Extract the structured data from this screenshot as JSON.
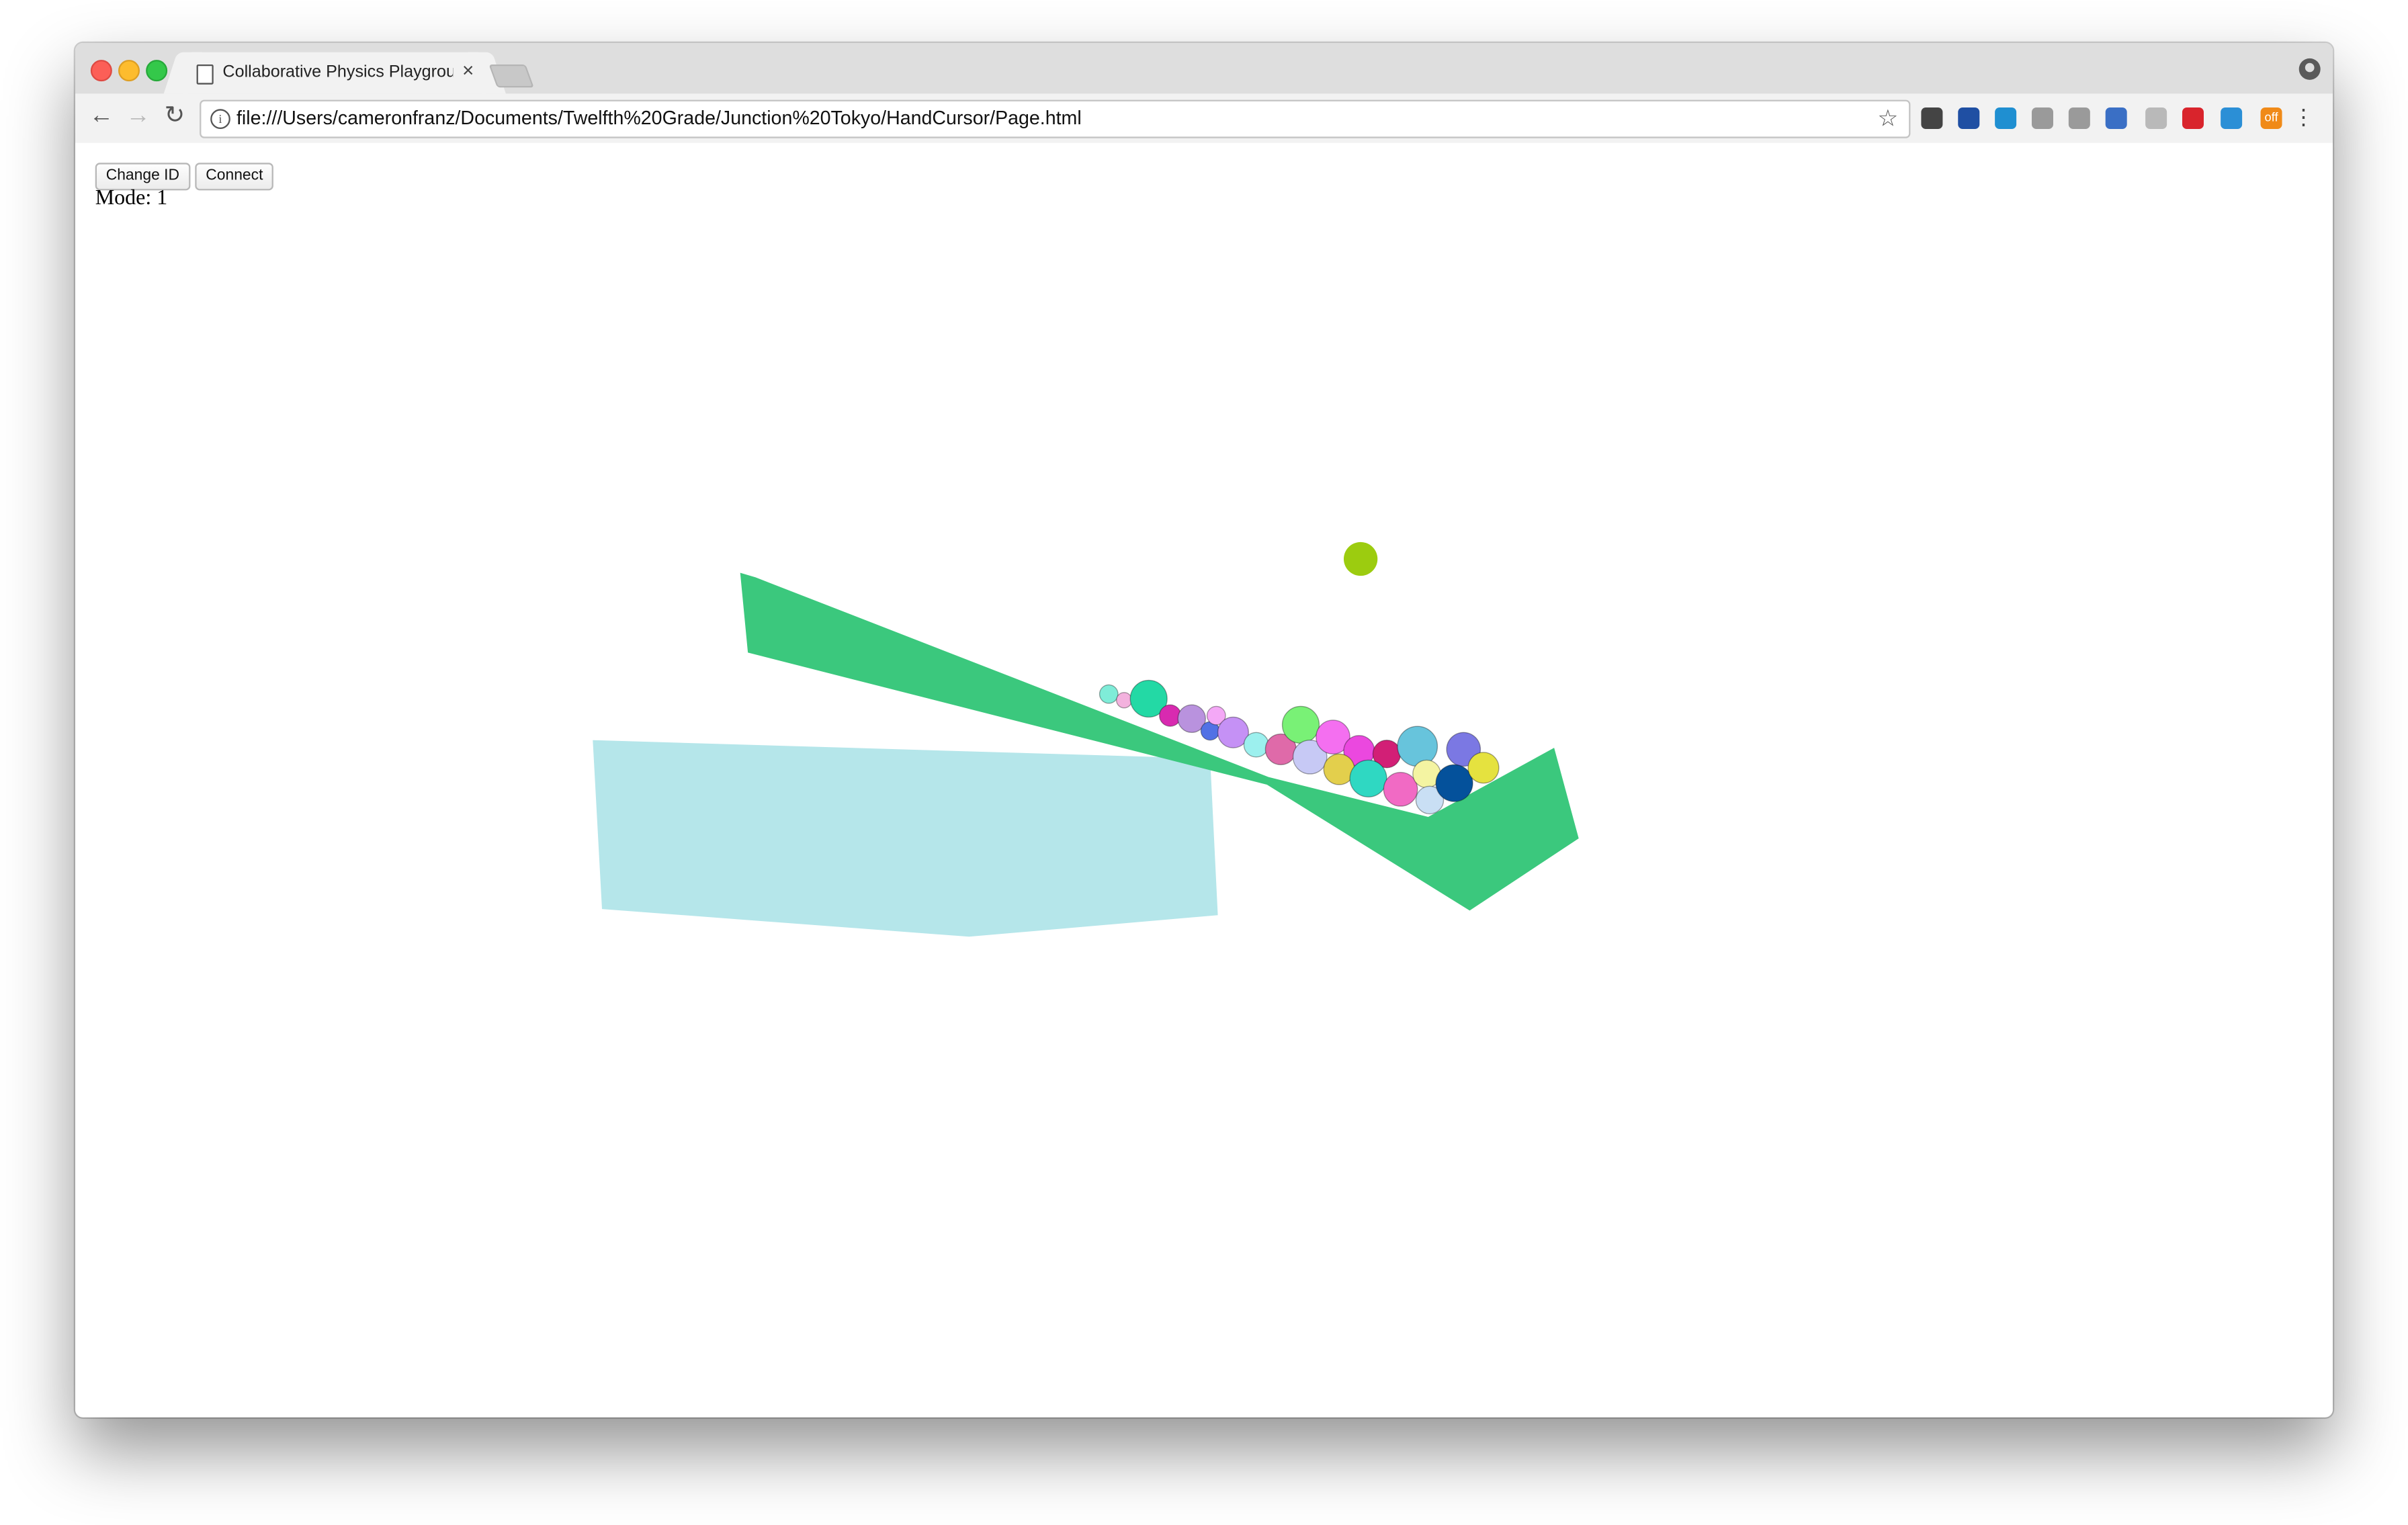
{
  "browser": {
    "tab_title": "Collaborative Physics Playground",
    "tab_close": "×",
    "url": "file:///Users/cameronfranz/Documents/Twelfth%20Grade/Junction%20Tokyo/HandCursor/Page.html",
    "nav": {
      "back": "←",
      "forward": "→",
      "reload": "↻"
    },
    "star": "☆",
    "menu": "⋮",
    "extensions": [
      {
        "name": "pocket-icon",
        "color": "#444444"
      },
      {
        "name": "eye-icon",
        "color": "#1f4fa3"
      },
      {
        "name": "target-icon",
        "color": "#1f8fd1"
      },
      {
        "name": "y-icon",
        "color": "#9a9a9a"
      },
      {
        "name": "pin-icon",
        "color": "#9a9a9a"
      },
      {
        "name": "globe-icon",
        "color": "#3a6fc5"
      },
      {
        "name": "comment-icon",
        "color": "#b9b9b9"
      },
      {
        "name": "plus-cross-icon",
        "color": "#d9242c"
      },
      {
        "name": "bar-chart-icon",
        "color": "#2b8fd6"
      },
      {
        "name": "off-badge-icon",
        "color": "#f08a18"
      }
    ],
    "off_badge": "off"
  },
  "page": {
    "change_id_label": "Change ID",
    "connect_label": "Connect",
    "mode_label": "Mode:",
    "mode_value": "1"
  },
  "scene": {
    "colors": {
      "ramp": "#3bc87d",
      "block": "#b5e6ea",
      "falling_ball": "#9ccc0f"
    },
    "ball_colors": [
      "#7fecd8",
      "#f3b2de",
      "#23d9a5",
      "#d82ab0",
      "#b992de",
      "#5271e5",
      "#f4a8f6",
      "#c591f5",
      "#9cf0ee",
      "#df6aa9",
      "#79f176",
      "#c7c9f5",
      "#f46ff0",
      "#eb48df",
      "#e3cf4c",
      "#d21f76",
      "#2fd8c2",
      "#f16ac4",
      "#67c4dc",
      "#f4f4a2",
      "#c9dff4",
      "#7b78e3",
      "#04519b",
      "#e5e23f"
    ]
  }
}
